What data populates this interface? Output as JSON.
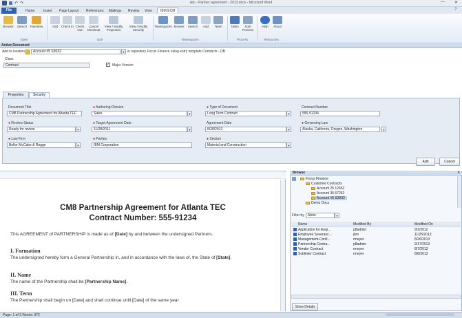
{
  "window": {
    "title": "abc - Partner agreement - 2013.docx - Microsoft Word"
  },
  "ribbon": {
    "tabs": [
      "File",
      "Home",
      "Insert",
      "Page Layout",
      "References",
      "Mailings",
      "Review",
      "View",
      "IBM ECM"
    ],
    "buttons": [
      "Browse",
      "Search",
      "Favorites",
      "Add",
      "Check In",
      "Check Out",
      "Cancel Checkout",
      "View / Modify Properties",
      "View / Modify Security",
      "Teamspaces",
      "Browse",
      "Search",
      "Add",
      "Team",
      "Tasks",
      "Start Process",
      "Help",
      "About"
    ],
    "groups": [
      "Open",
      "Edit",
      "Teamspaces",
      "Process",
      "Resources"
    ]
  },
  "active_document": {
    "header": "Active Document",
    "add_to_location_label": "Add to location",
    "location_value": "Account #5 S3032",
    "repository_text": "in repository Focus Finance using entry template Contracts - DB",
    "class_label": "Class",
    "class_value": "Contract",
    "major_version_label": "Major Version",
    "tabs": [
      "Properties",
      "Security"
    ],
    "fields": [
      {
        "label": "Document Title",
        "value": "CM8 Partnership Agreement for Atlanta TEC",
        "required": false
      },
      {
        "label": "Authoring Division",
        "value": "Sales",
        "required": true
      },
      {
        "label": "Type of Document",
        "value": "Long Term Contract",
        "required": true
      },
      {
        "label": "Contract Number",
        "value": "555-91234",
        "required": false
      },
      {
        "label": "Review Status",
        "value": "Ready for review",
        "required": true
      },
      {
        "label": "Target Agreement Date",
        "value": "11/28/2011",
        "required": true
      },
      {
        "label": "Agreement Date",
        "value": "8/28/2013",
        "required": false
      },
      {
        "label": "Governing Law",
        "value": "Alaska, California, Oregon, Washington",
        "required": true
      },
      {
        "label": "Law Firm",
        "value": "Bellor McCabe & Rogge",
        "required": true
      },
      {
        "label": "Parties",
        "value": "IBM Corporation",
        "required": true
      },
      {
        "label": "Section",
        "value": "Material and Construction",
        "required": true
      }
    ],
    "add_button": "Add",
    "cancel_button": "Cancel"
  },
  "document": {
    "title": "CM8 Partnership Agreement for Atlanta TEC",
    "subtitle": "Contract Number: 555-91234",
    "intro_pre": "This AGREEMENT of PARTNERSHIP is made as of ",
    "intro_date": "[Date]",
    "intro_post": " by and between the undersigned Partners.",
    "s1_title": "I. Formation",
    "s1_text_a": "The undersigned hereby form a General Partnership in, and in accordance with the laws of, the State of ",
    "s1_state": "[State]",
    "s2_title": "II. Name",
    "s2_text_a": "The name of the Partnership shall be ",
    "s2_name": "[Partnership Name]",
    "s3_title": "III. Term",
    "s3_text": "The Partnership shall begin on [Date] and shall continue until [Date] of the same year"
  },
  "browse": {
    "header": "Browse",
    "tree": [
      {
        "label": "Focus Finance",
        "level": 0
      },
      {
        "label": "Customer Contracts",
        "level": 1
      },
      {
        "label": "Account 25 12652",
        "level": 2
      },
      {
        "label": "Account 35 67252",
        "level": 2
      },
      {
        "label": "Account #5 S3032",
        "level": 2,
        "selected": true
      },
      {
        "label": "Demo Docs",
        "level": 1
      }
    ],
    "filter_label": "Filter by",
    "filter_value": "None",
    "columns": [
      "Name",
      "Modified By",
      "Modified On"
    ],
    "rows": [
      [
        "Application for Engi...",
        "p8admin",
        "9/1/2012"
      ],
      [
        "Employee Severanc...",
        "jhm",
        "11/25/2012"
      ],
      [
        "Management-Confi...",
        "rmeyer",
        "8/26/2013"
      ],
      [
        "Partnership-Contra...",
        "p8admin",
        "9/17/2013"
      ],
      [
        "Vendor Contract",
        "rmeyer",
        "8/7/2013"
      ],
      [
        "Sublinter Contract",
        "rmeyer",
        "8/8/2013"
      ]
    ],
    "show_details": "Show Details"
  },
  "status": {
    "left": "Page: 1 of 3   Words: 972"
  }
}
